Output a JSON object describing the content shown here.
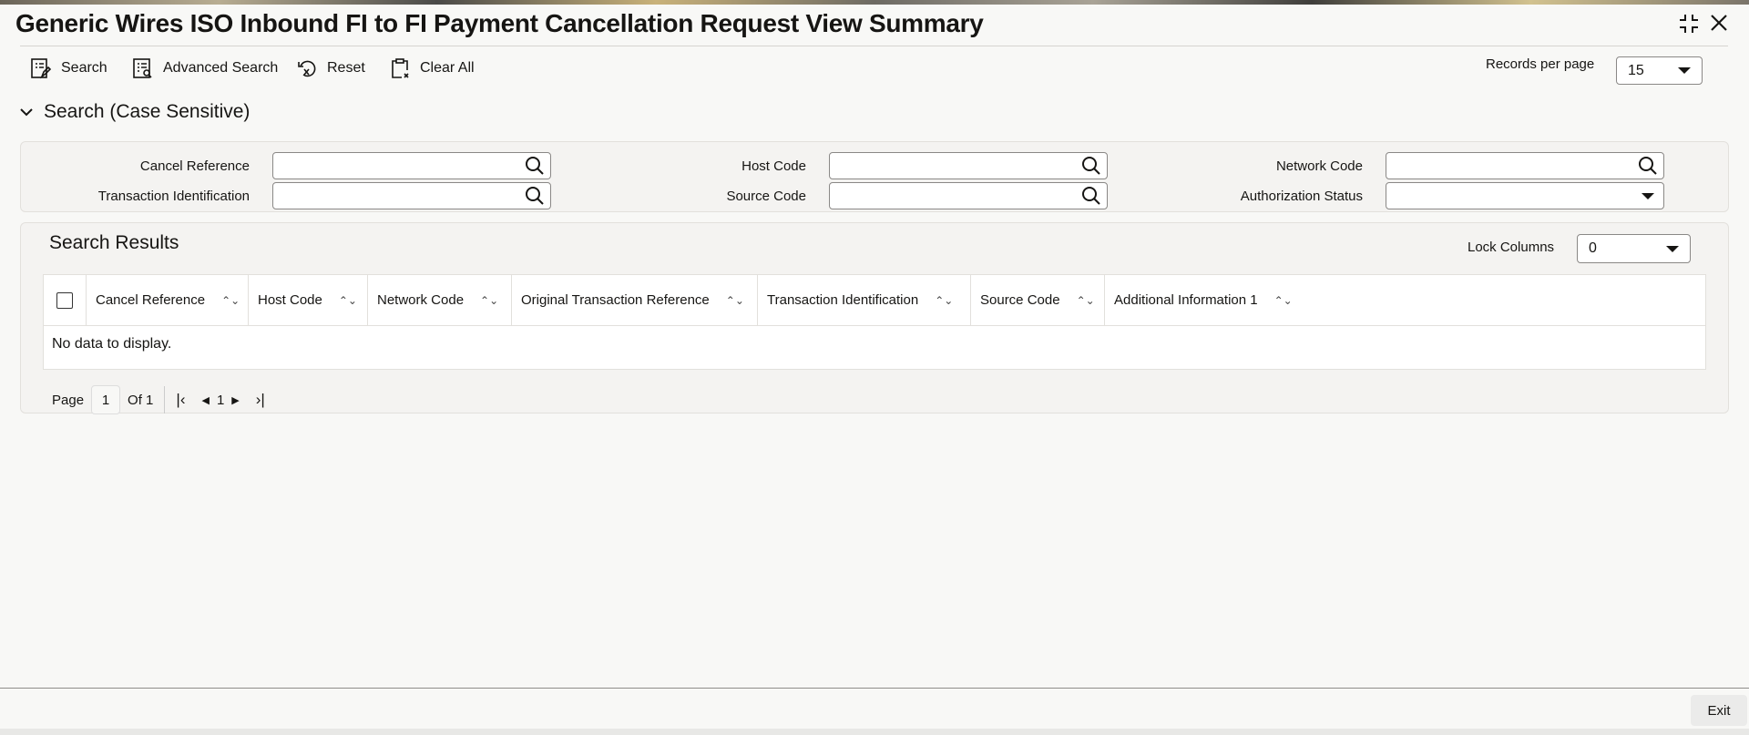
{
  "title": "Generic Wires ISO Inbound FI to FI Payment Cancellation Request View Summary",
  "toolbar": {
    "search": "Search",
    "advanced_search": "Advanced Search",
    "reset": "Reset",
    "clear_all": "Clear All"
  },
  "records_per_page": {
    "label": "Records per page",
    "value": "15"
  },
  "search_section": {
    "title": "Search (Case Sensitive)",
    "fields": {
      "cancel_reference": "Cancel Reference",
      "host_code": "Host Code",
      "network_code": "Network Code",
      "transaction_identification": "Transaction Identification",
      "source_code": "Source Code",
      "authorization_status": "Authorization Status"
    }
  },
  "results": {
    "title": "Search Results",
    "lock_columns_label": "Lock Columns",
    "lock_columns_value": "0",
    "columns": [
      "Cancel Reference",
      "Host Code",
      "Network Code",
      "Original Transaction Reference",
      "Transaction Identification",
      "Source Code",
      "Additional Information 1"
    ],
    "empty": "No data to display."
  },
  "pagination": {
    "page_label": "Page",
    "page": "1",
    "of": "Of 1",
    "current": "1"
  },
  "footer": {
    "exit": "Exit"
  }
}
